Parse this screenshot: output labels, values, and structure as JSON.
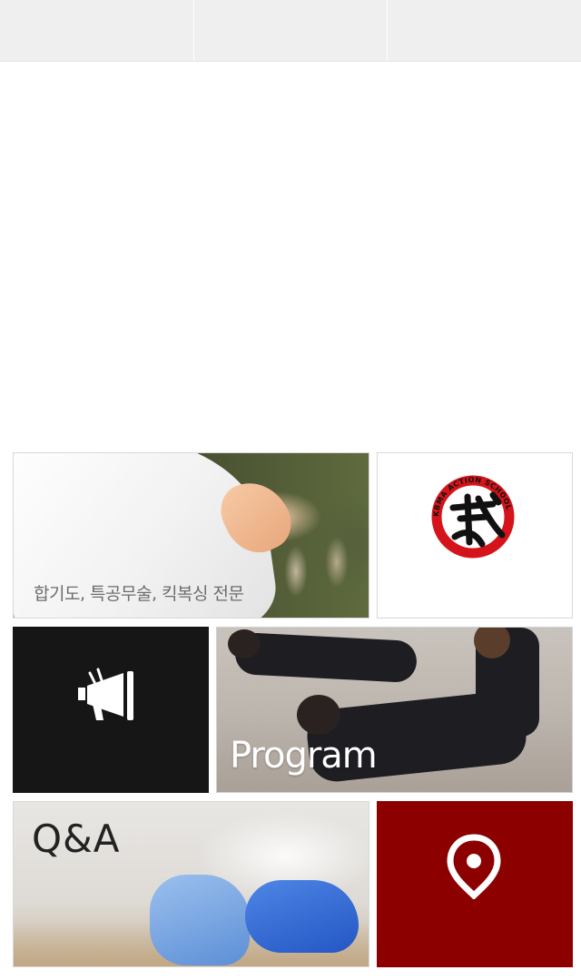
{
  "top_tabs": [
    "",
    "",
    ""
  ],
  "tiles": {
    "hero": {
      "caption": "합기도, 특공무술, 킥복싱 전문"
    },
    "logo": {
      "ring_text": "KBMA ACTION SCHOOL",
      "icon": "martial-arts-logo"
    },
    "notice": {
      "icon": "megaphone-icon"
    },
    "program": {
      "label": "Program"
    },
    "qa": {
      "label": "Q&A"
    },
    "map": {
      "icon": "location-pin-icon"
    }
  },
  "colors": {
    "topbar": "#efefef",
    "notice_bg": "#161616",
    "map_bg": "#8c0000",
    "logo_red": "#d4141a"
  }
}
